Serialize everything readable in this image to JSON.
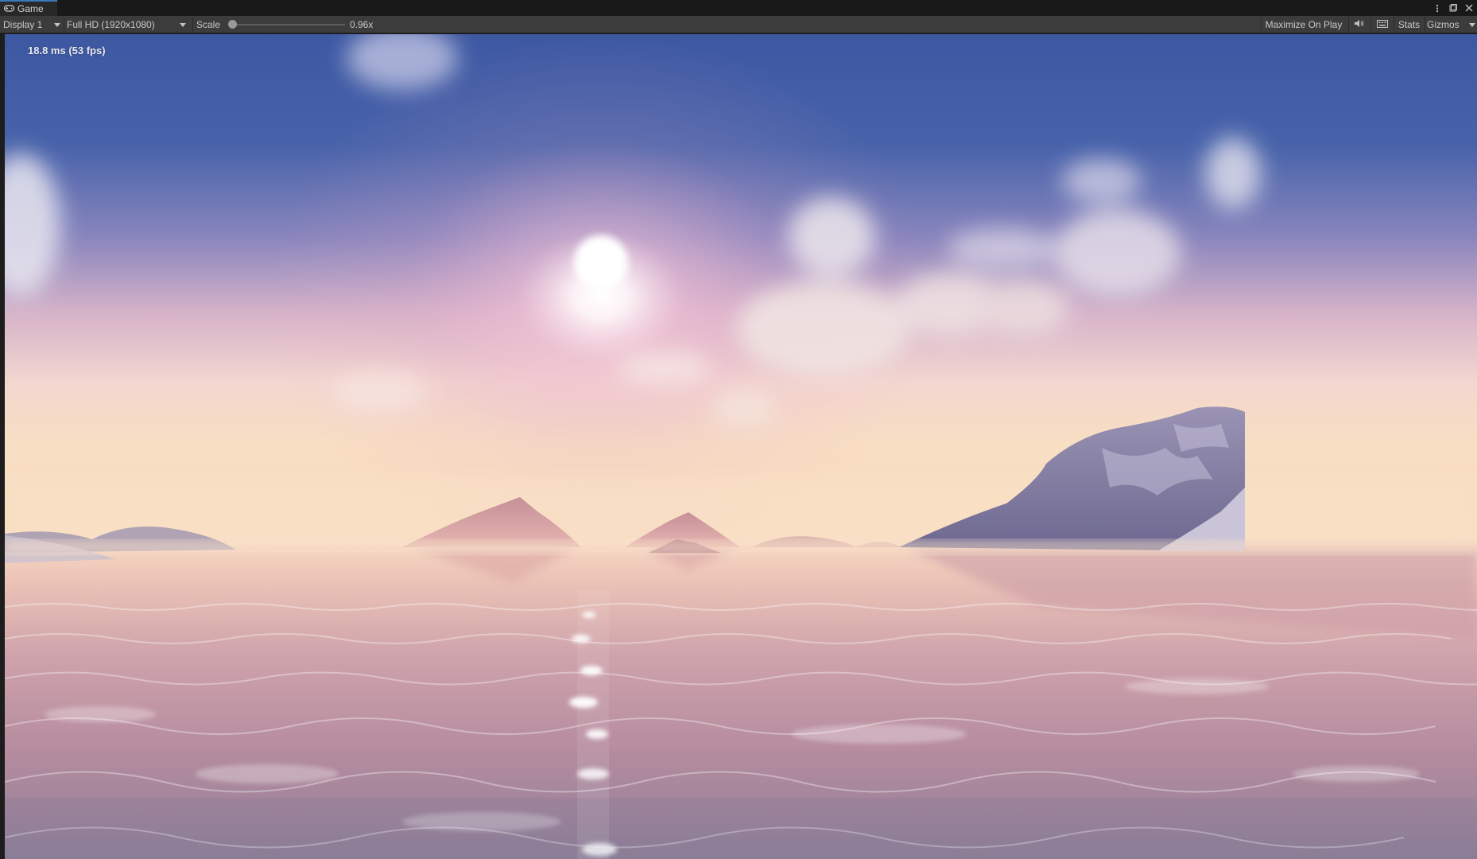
{
  "window": {
    "tab_label": "Game",
    "tab_icon": "gamepad-icon"
  },
  "toolbar": {
    "display_label": "Display 1",
    "resolution_label": "Full HD (1920x1080)",
    "scale_label": "Scale",
    "scale_value": "0.96x",
    "scale_fraction": 0.03,
    "maximize_label": "Maximize On Play",
    "audio_icon": "speaker-icon",
    "keyboard_icon": "keyboard-icon",
    "stats_label": "Stats",
    "gizmos_label": "Gizmos"
  },
  "viewport": {
    "fps_text": "18.8 ms (53 fps)"
  },
  "colors": {
    "sky_top": "#3f5aa3",
    "sky_mid": "#b892c0",
    "horizon": "#f8dcc0",
    "sea": "#d9aaa8",
    "accent": "#3a79bb"
  }
}
